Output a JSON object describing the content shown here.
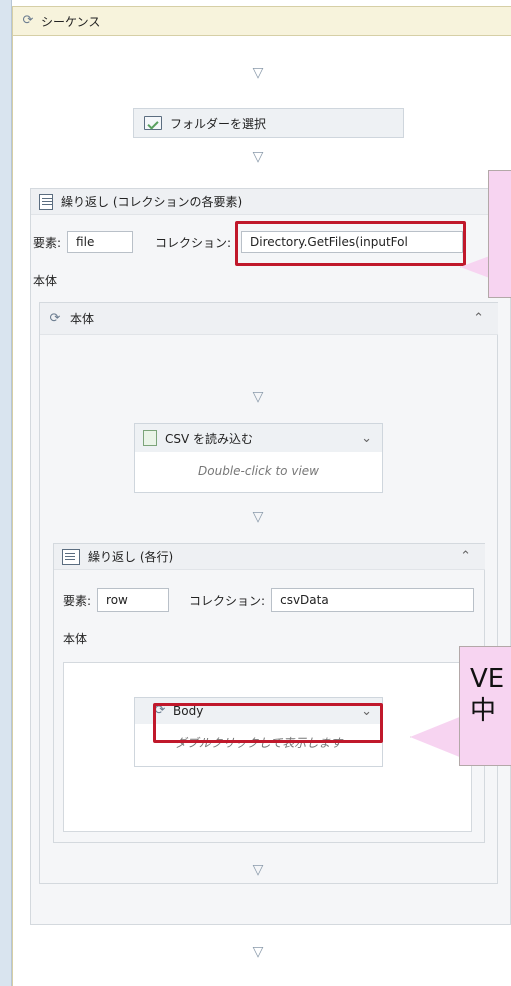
{
  "sequence": {
    "title": "シーケンス"
  },
  "select_folder": {
    "label": "フォルダーを選択"
  },
  "foreach_outer": {
    "title": "繰り返し (コレクションの各要素)",
    "element_label": "要素:",
    "element_value": "file",
    "collection_label": "コレクション:",
    "collection_value": "Directory.GetFiles(inputFol",
    "body_label": "本体"
  },
  "inner_body": {
    "title": "本体"
  },
  "read_csv": {
    "title": "CSV を読み込む",
    "hint": "Double-click to view"
  },
  "foreach_row": {
    "title": "繰り返し (各行)",
    "element_label": "要素:",
    "element_value": "row",
    "collection_label": "コレクション:",
    "collection_value": "csvData",
    "body_label": "本体"
  },
  "body_activity": {
    "title": "Body",
    "hint": "ダブルクリックして表示します"
  },
  "callout_bottom": {
    "line1": "VE",
    "line2": "中"
  },
  "icons": {
    "sequence": "sequence-icon",
    "arrow": "down-arrow-icon",
    "chevron_up": "chevron-up-icon",
    "chevron_down": "chevron-down-icon",
    "folder": "folder-icon"
  }
}
